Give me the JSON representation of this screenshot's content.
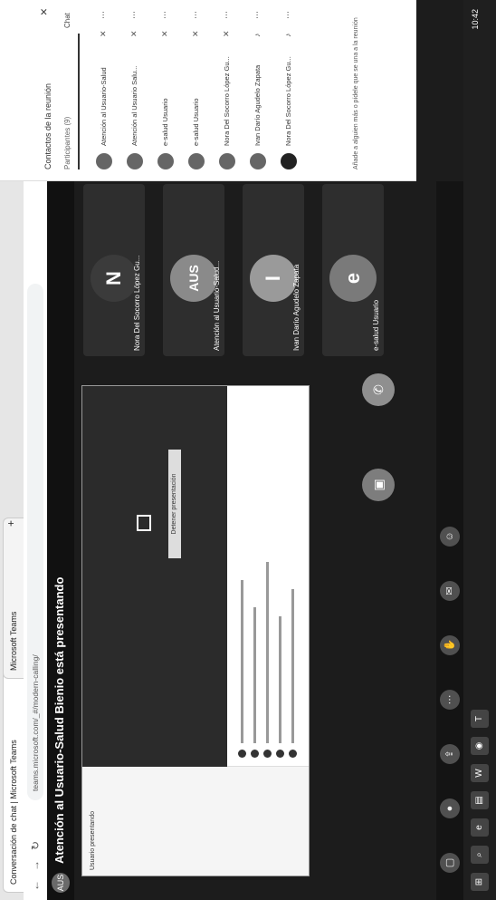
{
  "browser": {
    "tabs": [
      "Conversación de chat | Microsoft Teams",
      "Microsoft Teams"
    ],
    "url": "teams.microsoft.com/_#/modern-calling/",
    "new_tab": "+",
    "close_tab": "×"
  },
  "meeting": {
    "presenter_badge": "AUS",
    "title": "Atención al Usuario-Salud Bienio está presentando",
    "shared_panel_label": "Usuario presentando",
    "shared_button": "Detener presentación"
  },
  "tiles": [
    {
      "initial": "N",
      "name": "Nora Del Socorro López Gu..."
    },
    {
      "initial": "AUS",
      "name": "Atención al Usuario-Salud..."
    },
    {
      "initial": "I",
      "name": "Ivan Darío Agudelo Zapata"
    },
    {
      "initial": "e",
      "name": "e-salud Usuario"
    }
  ],
  "panel": {
    "title": "Contactos de la reunión",
    "search": "Participantes (9)",
    "chat": "Chat",
    "close": "×",
    "participants": [
      "Atención al Usuario-Salud",
      "Atención al Usuario Salu...",
      "e-salud Usuario",
      "e-salud Usuario",
      "Nora Del Socorro López Gu...",
      "Ivan Darío Agudelo Zapata",
      "Nora Del Socorro López Gu..."
    ],
    "footer": "Añade a alguien más o pídele que se una a la reunión"
  },
  "taskbar": {
    "clock": "10:42"
  }
}
